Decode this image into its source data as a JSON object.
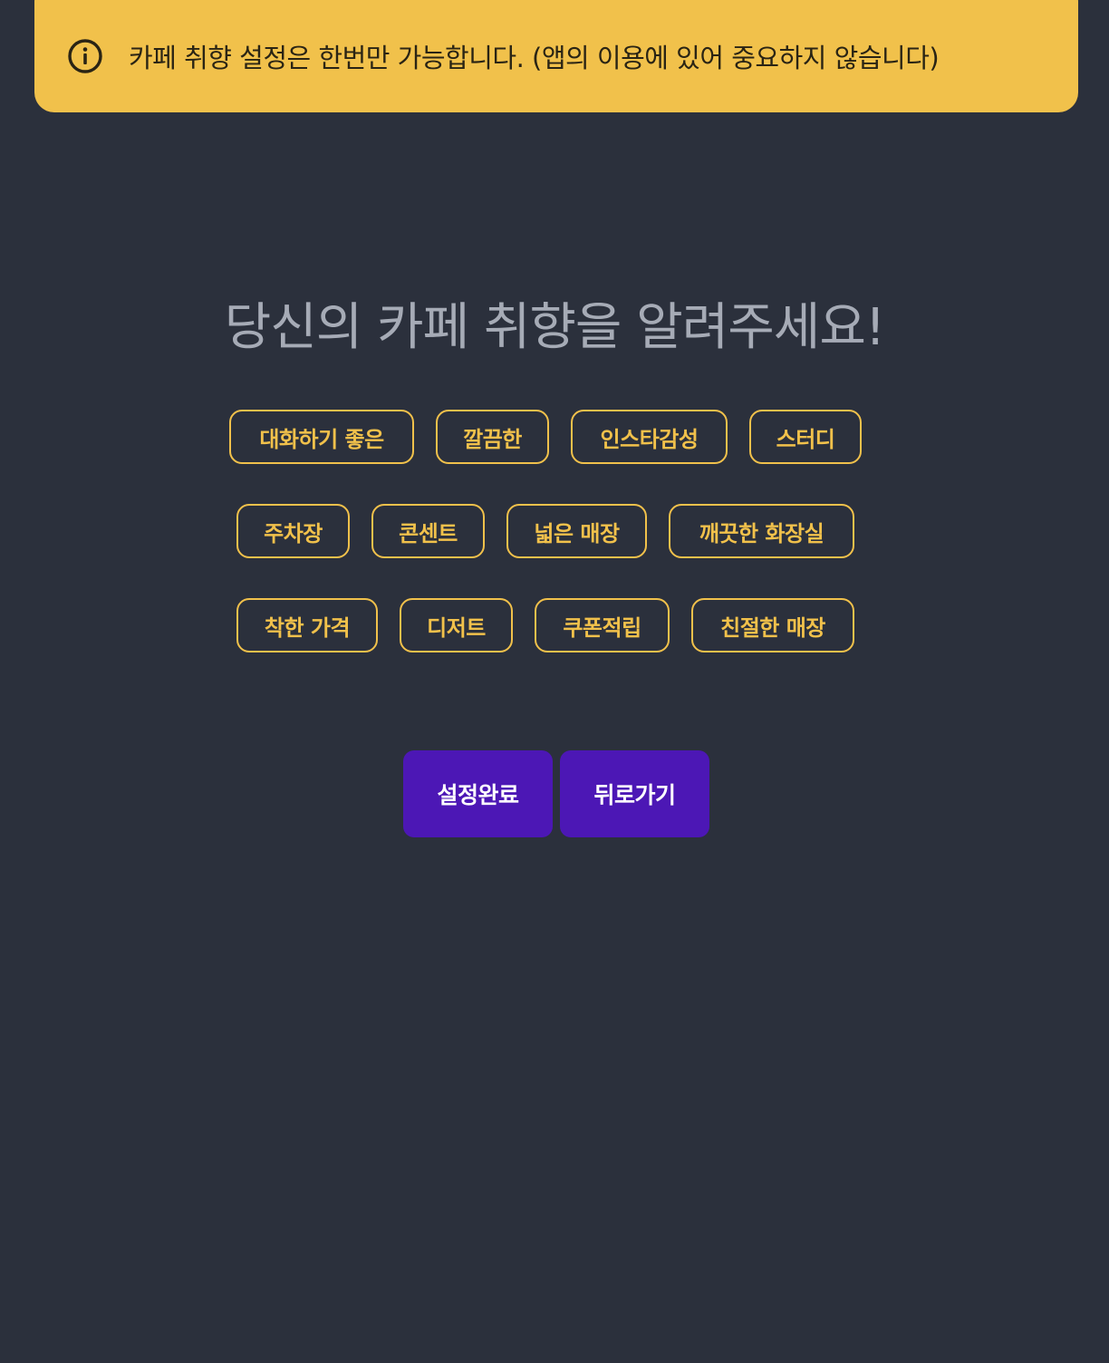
{
  "alert": {
    "icon": "info-circle-icon",
    "message": "카페 취향 설정은 한번만 가능합니다. (앱의 이용에 있어 중요하지 않습니다)",
    "background_color": "#f1c14b"
  },
  "title": "당신의 카페 취향을 알려주세요!",
  "tags": [
    {
      "label": "대화하기 좋은"
    },
    {
      "label": "깔끔한"
    },
    {
      "label": "인스타감성"
    },
    {
      "label": "스터디"
    },
    {
      "label": "주차장"
    },
    {
      "label": "콘센트"
    },
    {
      "label": "넓은 매장"
    },
    {
      "label": "깨끗한 화장실"
    },
    {
      "label": "착한 가격"
    },
    {
      "label": "디저트"
    },
    {
      "label": "쿠폰적립"
    },
    {
      "label": "친절한 매장"
    }
  ],
  "buttons": {
    "complete_label": "설정완료",
    "back_label": "뒤로가기"
  },
  "colors": {
    "background": "#2b303c",
    "accent": "#f1c14b",
    "button": "#4c17b5"
  }
}
